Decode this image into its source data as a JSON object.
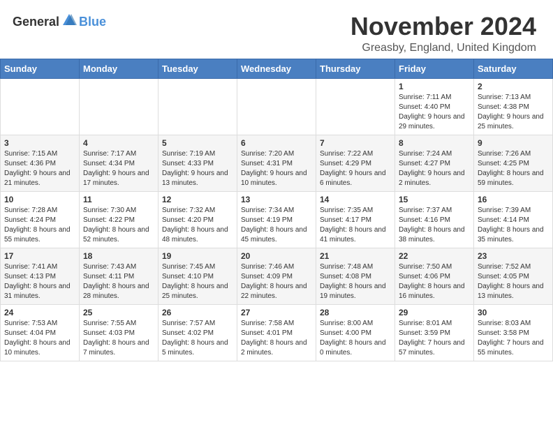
{
  "header": {
    "logo_general": "General",
    "logo_blue": "Blue",
    "month_title": "November 2024",
    "location": "Greasby, England, United Kingdom"
  },
  "weekdays": [
    "Sunday",
    "Monday",
    "Tuesday",
    "Wednesday",
    "Thursday",
    "Friday",
    "Saturday"
  ],
  "weeks": [
    [
      {
        "day": "",
        "info": ""
      },
      {
        "day": "",
        "info": ""
      },
      {
        "day": "",
        "info": ""
      },
      {
        "day": "",
        "info": ""
      },
      {
        "day": "",
        "info": ""
      },
      {
        "day": "1",
        "info": "Sunrise: 7:11 AM\nSunset: 4:40 PM\nDaylight: 9 hours and 29 minutes."
      },
      {
        "day": "2",
        "info": "Sunrise: 7:13 AM\nSunset: 4:38 PM\nDaylight: 9 hours and 25 minutes."
      }
    ],
    [
      {
        "day": "3",
        "info": "Sunrise: 7:15 AM\nSunset: 4:36 PM\nDaylight: 9 hours and 21 minutes."
      },
      {
        "day": "4",
        "info": "Sunrise: 7:17 AM\nSunset: 4:34 PM\nDaylight: 9 hours and 17 minutes."
      },
      {
        "day": "5",
        "info": "Sunrise: 7:19 AM\nSunset: 4:33 PM\nDaylight: 9 hours and 13 minutes."
      },
      {
        "day": "6",
        "info": "Sunrise: 7:20 AM\nSunset: 4:31 PM\nDaylight: 9 hours and 10 minutes."
      },
      {
        "day": "7",
        "info": "Sunrise: 7:22 AM\nSunset: 4:29 PM\nDaylight: 9 hours and 6 minutes."
      },
      {
        "day": "8",
        "info": "Sunrise: 7:24 AM\nSunset: 4:27 PM\nDaylight: 9 hours and 2 minutes."
      },
      {
        "day": "9",
        "info": "Sunrise: 7:26 AM\nSunset: 4:25 PM\nDaylight: 8 hours and 59 minutes."
      }
    ],
    [
      {
        "day": "10",
        "info": "Sunrise: 7:28 AM\nSunset: 4:24 PM\nDaylight: 8 hours and 55 minutes."
      },
      {
        "day": "11",
        "info": "Sunrise: 7:30 AM\nSunset: 4:22 PM\nDaylight: 8 hours and 52 minutes."
      },
      {
        "day": "12",
        "info": "Sunrise: 7:32 AM\nSunset: 4:20 PM\nDaylight: 8 hours and 48 minutes."
      },
      {
        "day": "13",
        "info": "Sunrise: 7:34 AM\nSunset: 4:19 PM\nDaylight: 8 hours and 45 minutes."
      },
      {
        "day": "14",
        "info": "Sunrise: 7:35 AM\nSunset: 4:17 PM\nDaylight: 8 hours and 41 minutes."
      },
      {
        "day": "15",
        "info": "Sunrise: 7:37 AM\nSunset: 4:16 PM\nDaylight: 8 hours and 38 minutes."
      },
      {
        "day": "16",
        "info": "Sunrise: 7:39 AM\nSunset: 4:14 PM\nDaylight: 8 hours and 35 minutes."
      }
    ],
    [
      {
        "day": "17",
        "info": "Sunrise: 7:41 AM\nSunset: 4:13 PM\nDaylight: 8 hours and 31 minutes."
      },
      {
        "day": "18",
        "info": "Sunrise: 7:43 AM\nSunset: 4:11 PM\nDaylight: 8 hours and 28 minutes."
      },
      {
        "day": "19",
        "info": "Sunrise: 7:45 AM\nSunset: 4:10 PM\nDaylight: 8 hours and 25 minutes."
      },
      {
        "day": "20",
        "info": "Sunrise: 7:46 AM\nSunset: 4:09 PM\nDaylight: 8 hours and 22 minutes."
      },
      {
        "day": "21",
        "info": "Sunrise: 7:48 AM\nSunset: 4:08 PM\nDaylight: 8 hours and 19 minutes."
      },
      {
        "day": "22",
        "info": "Sunrise: 7:50 AM\nSunset: 4:06 PM\nDaylight: 8 hours and 16 minutes."
      },
      {
        "day": "23",
        "info": "Sunrise: 7:52 AM\nSunset: 4:05 PM\nDaylight: 8 hours and 13 minutes."
      }
    ],
    [
      {
        "day": "24",
        "info": "Sunrise: 7:53 AM\nSunset: 4:04 PM\nDaylight: 8 hours and 10 minutes."
      },
      {
        "day": "25",
        "info": "Sunrise: 7:55 AM\nSunset: 4:03 PM\nDaylight: 8 hours and 7 minutes."
      },
      {
        "day": "26",
        "info": "Sunrise: 7:57 AM\nSunset: 4:02 PM\nDaylight: 8 hours and 5 minutes."
      },
      {
        "day": "27",
        "info": "Sunrise: 7:58 AM\nSunset: 4:01 PM\nDaylight: 8 hours and 2 minutes."
      },
      {
        "day": "28",
        "info": "Sunrise: 8:00 AM\nSunset: 4:00 PM\nDaylight: 8 hours and 0 minutes."
      },
      {
        "day": "29",
        "info": "Sunrise: 8:01 AM\nSunset: 3:59 PM\nDaylight: 7 hours and 57 minutes."
      },
      {
        "day": "30",
        "info": "Sunrise: 8:03 AM\nSunset: 3:58 PM\nDaylight: 7 hours and 55 minutes."
      }
    ]
  ]
}
